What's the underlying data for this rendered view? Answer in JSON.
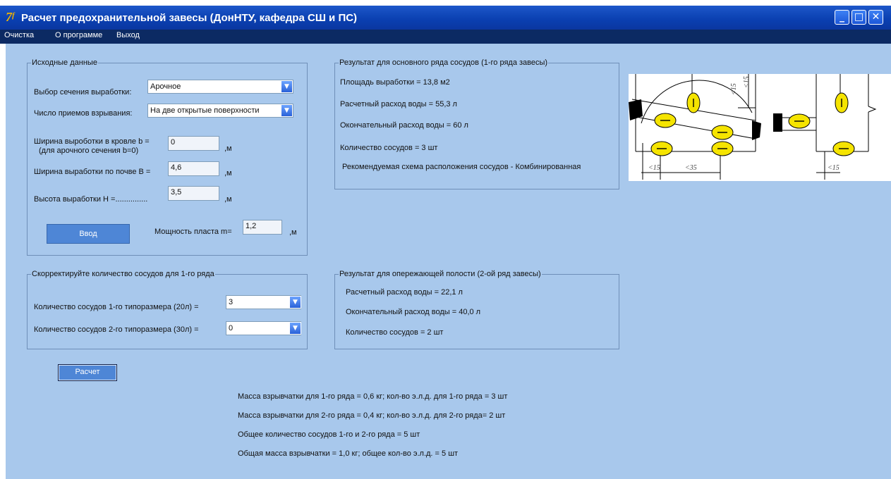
{
  "window": {
    "title": "Расчет предохранительной завесы (ДонНТУ, кафедра СШ и ПС)",
    "icon": "delphi-app-icon"
  },
  "menu": [
    "Очистка",
    "О программе",
    "Выход"
  ],
  "input": {
    "legend": "Исходные данные",
    "section_label": "Выбор сечения выработки:",
    "section_value": "Арочное",
    "blast_label": "Число приемов взрывания:",
    "blast_value": "На две открытые поверхности",
    "roof_width_label": "Ширина выроботки в кровле b =",
    "roof_width_note": "(для арочного сечения b=0)",
    "roof_width_value": "0",
    "floor_width_label": "Ширина выработки по почве В =",
    "floor_width_value": "4,6",
    "height_label": "Высота выработки Н =...............",
    "height_value": "3,5",
    "unit": ",м",
    "enter_button": "Ввод",
    "seam_label": "Мощность пласта m=",
    "seam_value": "1,2"
  },
  "result1": {
    "legend": "Результат для основного ряда сосудов (1-го ряда завесы)",
    "area": "Площадь выработки = 13,8 м2",
    "calc_water": "Расчетный расход воды = 55,3 л",
    "final_water": "Окончательный расход воды = 60 л",
    "vessels": "Количество сосудов = 3 шт",
    "scheme": "Рекомендуемая схема расположения сосудов - Комбинированная"
  },
  "correction": {
    "legend": "Скорректируйте количество сосудов для 1-го ряда",
    "type1_label": "Количество сосудов 1-го типоразмера (20л) =",
    "type1_value": "3",
    "type2_label": "Количество сосудов 2-го типоразмера (30л) =",
    "type2_value": "0"
  },
  "result2": {
    "legend": "Результат для опережающей полости (2-ой ряд завесы)",
    "calc_water": "Расчетный расход воды =  22,1 л",
    "final_water": "Окончательный расход воды =  40,0 л",
    "vessels": "Количество сосудов = 2 шт"
  },
  "calc_button": "Расчет",
  "summary": [
    "Масса взрывчатки для 1-го ряда = 0,6 кг;  кол-во э.л.д. для 1-го ряда = 3 шт",
    "Масса взрывчатки для 2-го ряда = 0,4 кг;  кол-во э.л.д. для 2-го ряда= 2 шт",
    "Общее количество сосудов 1-го и 2-го ряда = 5 шт",
    "Общая масса взрывчатки = 1,0 кг;  общее кол-во э.л.д. = 5 шт"
  ],
  "diagram": {
    "dims": [
      "<15",
      "<35",
      "<15",
      "<15",
      "<15"
    ]
  },
  "colors": {
    "client_bg": "#a8c8ec",
    "titlebar": "#0a3fb0",
    "menubar": "#0c2a63",
    "button": "#4e86d6",
    "vessel": "#f5e400"
  }
}
